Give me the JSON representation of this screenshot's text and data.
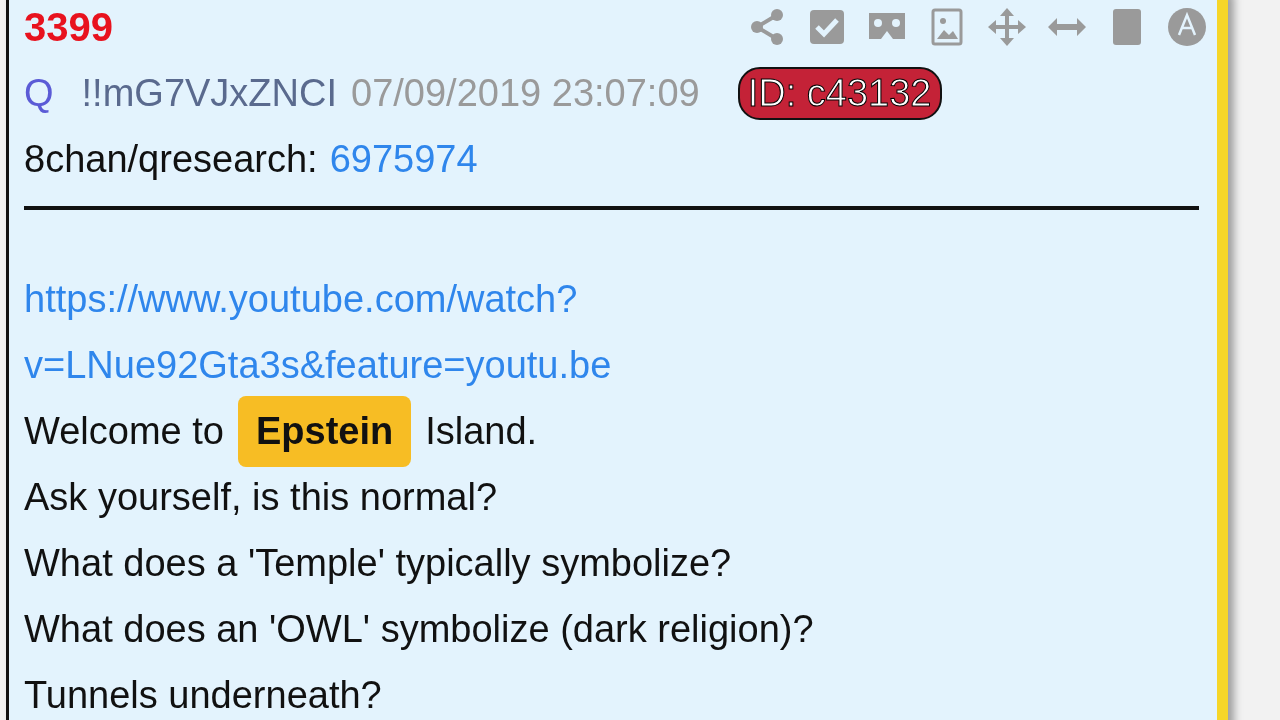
{
  "post": {
    "number": "3399",
    "author": "Q",
    "tripcode": "!!mG7VJxZNCI",
    "timestamp": "07/09/2019 23:07:09",
    "id_badge": "ID: c43132",
    "source": {
      "board": "8chan/qresearch:",
      "ref": "6975974"
    },
    "body": [
      {
        "kind": "link",
        "parts": [
          {
            "text": "https://www.youtube.com/watch?"
          }
        ]
      },
      {
        "kind": "link",
        "parts": [
          {
            "text": "v=LNue92Gta3s&feature=youtu.be"
          }
        ]
      },
      {
        "kind": "text",
        "parts": [
          {
            "text": "Welcome to"
          },
          {
            "text": "Epstein",
            "highlight": true
          },
          {
            "text": "Island."
          }
        ]
      },
      {
        "kind": "text",
        "parts": [
          {
            "text": "Ask yourself, is this normal?"
          }
        ]
      },
      {
        "kind": "text",
        "parts": [
          {
            "text": "What does a 'Temple' typically symbolize?"
          }
        ]
      },
      {
        "kind": "text",
        "parts": [
          {
            "text": "What does an 'OWL' symbolize (dark religion)?"
          }
        ]
      },
      {
        "kind": "text",
        "parts": [
          {
            "text": "Tunnels underneath?"
          }
        ]
      }
    ]
  }
}
